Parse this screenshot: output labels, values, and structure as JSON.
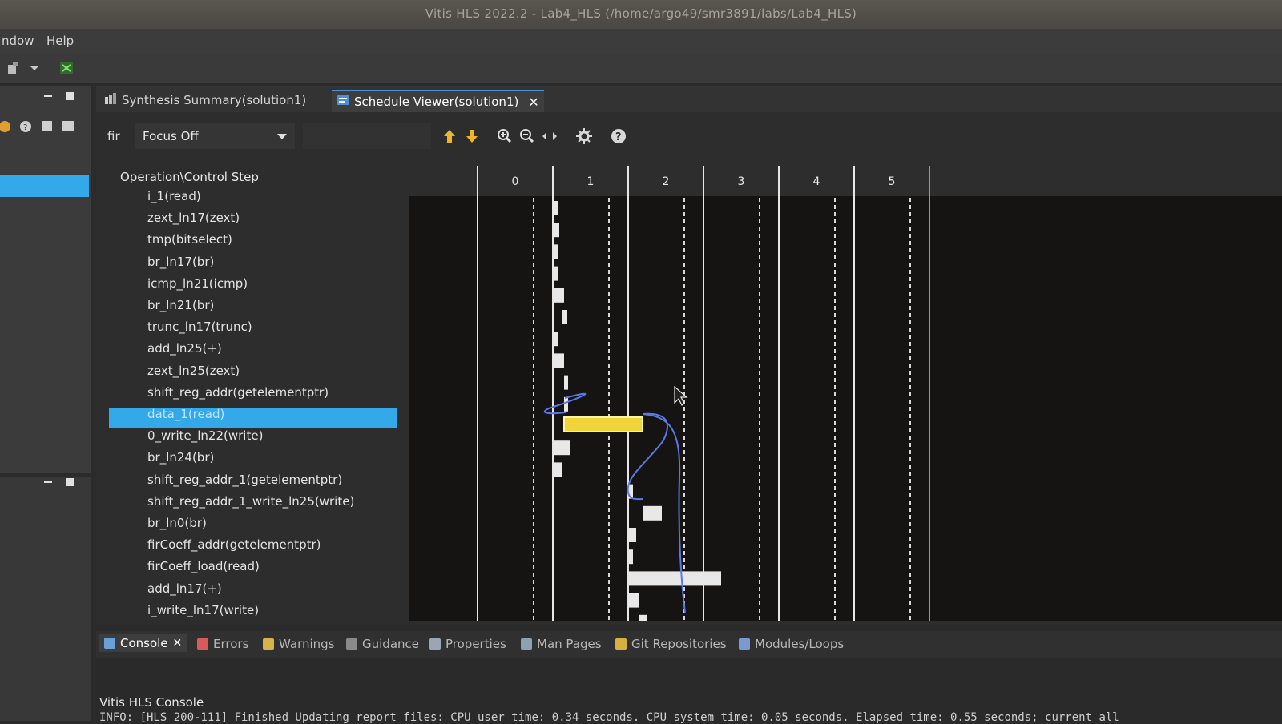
{
  "window": {
    "title": "Vitis HLS 2022.2 - Lab4_HLS (/home/argo49/smr3891/labs/Lab4_HLS)"
  },
  "menu": [
    "ndow",
    "Help"
  ],
  "editor_tabs": [
    {
      "label": "Synthesis Summary(solution1)",
      "active": false,
      "closable": false
    },
    {
      "label": "Schedule Viewer(solution1)",
      "active": true,
      "closable": true
    }
  ],
  "viewer": {
    "function": "fir",
    "focus": "Focus Off",
    "header": "Operation\\Control Step",
    "steps": [
      "0",
      "1",
      "2",
      "3",
      "4",
      "5"
    ],
    "operations": [
      "i_1(read)",
      "zext_ln17(zext)",
      "tmp(bitselect)",
      "br_ln17(br)",
      "icmp_ln21(icmp)",
      "br_ln21(br)",
      "trunc_ln17(trunc)",
      "add_ln25(+)",
      "zext_ln25(zext)",
      "shift_reg_addr(getelementptr)",
      "data_1(read)",
      "0_write_ln22(write)",
      "br_ln24(br)",
      "shift_reg_addr_1(getelementptr)",
      "shift_reg_addr_1_write_ln25(write)",
      "br_ln0(br)",
      "firCoeff_addr(getelementptr)",
      "firCoeff_load(read)",
      "add_ln17(+)",
      "i_write_ln17(write)"
    ],
    "selected_operation": 10,
    "colors": {
      "selection": "#33a9ea",
      "highlight_bar": "#f0d43a",
      "bar": "#e8e8e8",
      "arrow": "#5a78e6",
      "end_line": "#5fbf4a"
    }
  },
  "bottom_tabs": [
    {
      "label": "Console",
      "active": true,
      "icon": "console-icon"
    },
    {
      "label": "Errors",
      "active": false,
      "icon": "errors-icon"
    },
    {
      "label": "Warnings",
      "active": false,
      "icon": "warnings-icon"
    },
    {
      "label": "Guidance",
      "active": false,
      "icon": "guidance-icon"
    },
    {
      "label": "Properties",
      "active": false,
      "icon": "properties-icon"
    },
    {
      "label": "Man Pages",
      "active": false,
      "icon": "man-pages-icon"
    },
    {
      "label": "Git Repositories",
      "active": false,
      "icon": "git-icon"
    },
    {
      "label": "Modules/Loops",
      "active": false,
      "icon": "modules-icon"
    }
  ],
  "console": {
    "title": "Vitis HLS Console",
    "line": "INFO: [HLS 200-111] Finished Updating report files: CPU user time: 0.34 seconds. CPU system time: 0.05 seconds. Elapsed time: 0.55 seconds; current all"
  }
}
